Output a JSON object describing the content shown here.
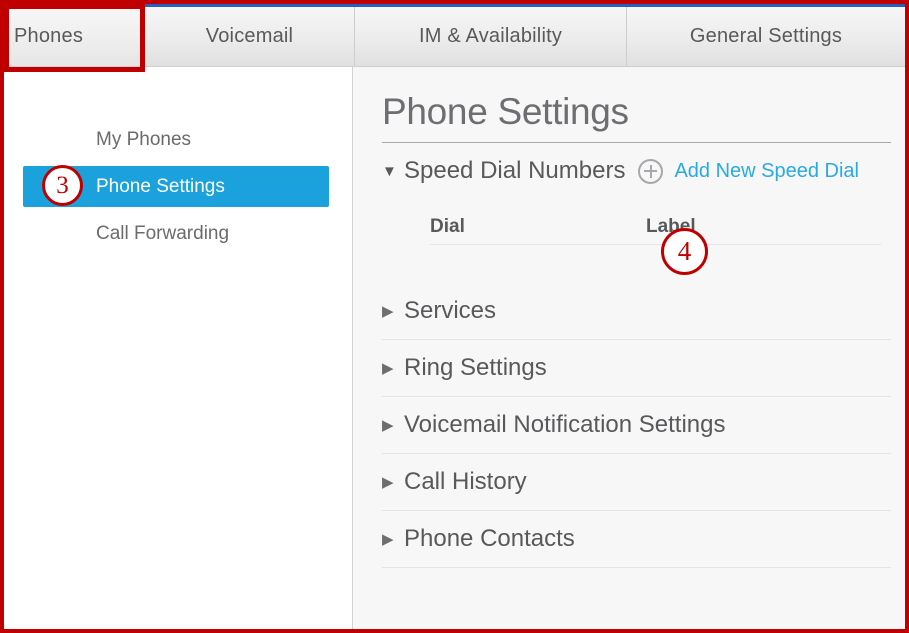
{
  "window": {
    "title": "Phone Settings",
    "accent_blue": "#1ba1dc",
    "link_blue": "#29aae3",
    "annotation_red": "#c00000",
    "tab_top_line": "#2a5fbf"
  },
  "tabs": [
    {
      "label": "Phones",
      "active": true,
      "name": "tab-phones"
    },
    {
      "label": "Voicemail",
      "active": false,
      "name": "tab-voicemail"
    },
    {
      "label": "IM & Availability",
      "active": false,
      "name": "tab-im-availability"
    },
    {
      "label": "General Settings",
      "active": false,
      "name": "tab-general-settings"
    }
  ],
  "sidebar": {
    "items": [
      {
        "label": "My Phones",
        "active": false
      },
      {
        "label": "Phone Settings",
        "active": true
      },
      {
        "label": "Call Forwarding",
        "active": false
      }
    ]
  },
  "main": {
    "page_title": "Phone Settings",
    "sections": [
      {
        "label": "Speed Dial Numbers",
        "expanded": true,
        "triangle": "▼"
      },
      {
        "label": "Services",
        "expanded": false,
        "triangle": "▶"
      },
      {
        "label": "Ring Settings",
        "expanded": false,
        "triangle": "▶"
      },
      {
        "label": "Voicemail Notification Settings",
        "expanded": false,
        "triangle": "▶"
      },
      {
        "label": "Call History",
        "expanded": false,
        "triangle": "▶"
      },
      {
        "label": "Phone Contacts",
        "expanded": false,
        "triangle": "▶"
      }
    ],
    "speed_dial": {
      "add_link_label": "Add New Speed Dial",
      "add_icon": "plus-circle-icon",
      "columns": [
        "Dial",
        "Label"
      ],
      "rows": []
    }
  },
  "callouts": [
    {
      "number": "3",
      "target": "sidebar-item-phone-settings"
    },
    {
      "number": "4",
      "target": "add-new-speed-dial-button"
    }
  ]
}
